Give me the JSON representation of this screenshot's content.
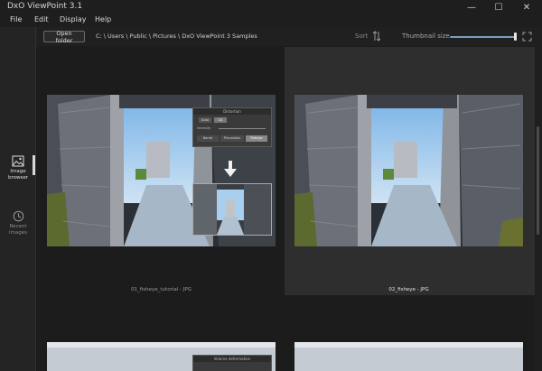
{
  "window": {
    "title": "DxO ViewPoint 3.1",
    "minimize": "—",
    "maximize": "☐",
    "close": "✕"
  },
  "menu": {
    "items": [
      "File",
      "Edit",
      "Display",
      "Help"
    ]
  },
  "toolbar": {
    "open_folder_label": "Open folder",
    "path": "C: \\ Users \\ Public \\ Pictures \\ DxO ViewPoint 3 Samples",
    "sort_label": "Sort",
    "thumbnail_size_label": "Thumbnail size",
    "thumbnail_size_level": 0.97
  },
  "sidebar": {
    "items": [
      {
        "label": "Image browser",
        "icon": "image-icon",
        "active": true
      },
      {
        "label": "Recent images",
        "icon": "clock-icon",
        "active": false
      }
    ]
  },
  "overlay": {
    "title": "Distortion",
    "mode_auto": "Auto",
    "mode_lens": "CS",
    "intensity_label": "Intensity",
    "buttons": [
      "Barrel",
      "Pincushion",
      "Fisheye"
    ],
    "bottom_title": "Volume deformation"
  },
  "images": [
    {
      "caption": "01_fisheye_tutorial - JPG",
      "selected": false
    },
    {
      "caption": "02_fisheye - JPG",
      "selected": true
    }
  ],
  "colors": {
    "accent": "#7a9ec0",
    "selected_bg": "#2e2e2e",
    "background": "#1c1c1c"
  }
}
